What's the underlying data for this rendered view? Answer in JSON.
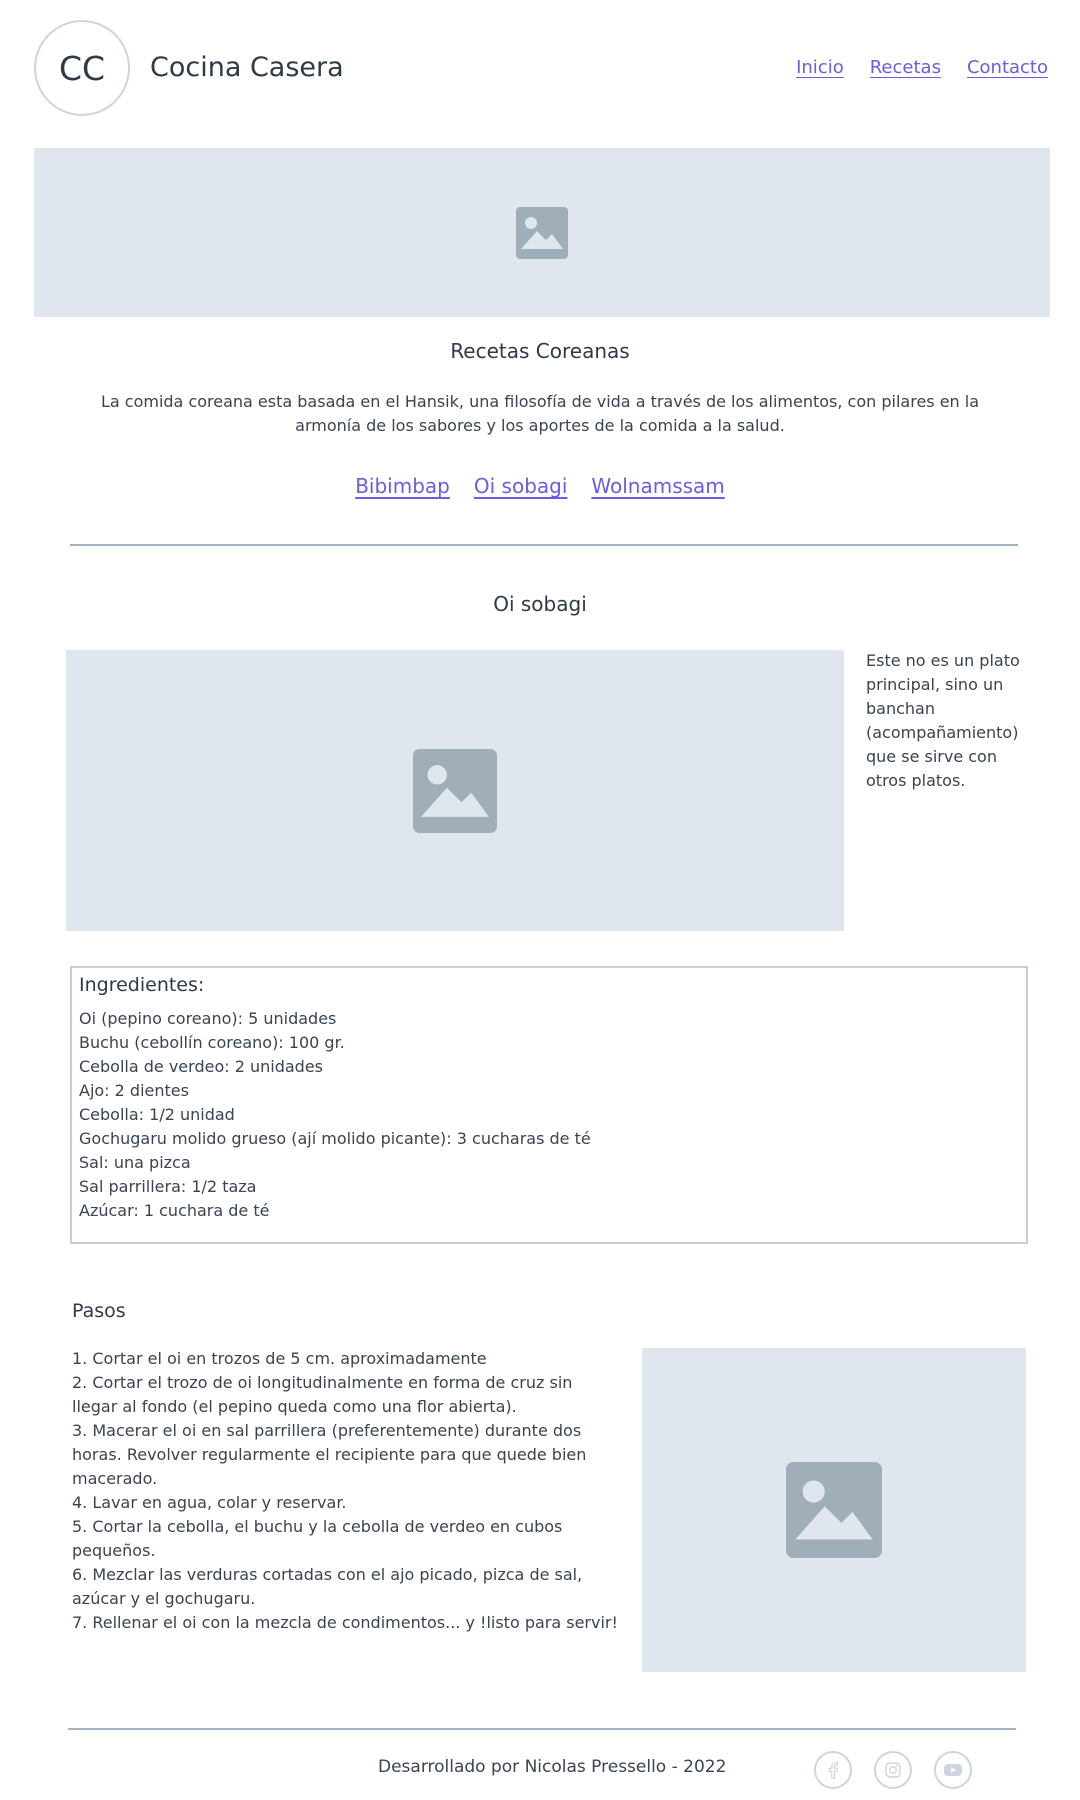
{
  "header": {
    "logo": "CC",
    "brand": "Cocina Casera",
    "nav": [
      "Inicio",
      "Recetas",
      "Contacto"
    ]
  },
  "hero": {
    "icon": "image-placeholder-icon"
  },
  "intro": {
    "title": "Recetas Coreanas",
    "text": "La comida coreana esta basada en el Hansik, una filosofía de vida a través de los alimentos, con pilares en la armonía de los sabores y los aportes de la comida a la salud.",
    "links": [
      "Bibimbap",
      "Oi sobagi",
      "Wolnamssam"
    ]
  },
  "recipe": {
    "title": "Oi sobagi",
    "description": "Este no es un plato principal, sino un banchan (acompañamiento) que se sirve con otros platos.",
    "ingredients_title": "Ingredientes:",
    "ingredients": [
      "Oi (pepino coreano): 5 unidades",
      "Buchu (cebollín coreano): 100 gr.",
      "Cebolla de verdeo: 2 unidades",
      "Ajo: 2 dientes",
      "Cebolla: 1/2 unidad",
      "Gochugaru molido grueso (ají molido picante): 3 cucharas de té",
      "Sal: una pizca",
      "Sal parrillera: 1/2 taza",
      "Azúcar: 1 cuchara de té"
    ],
    "steps_title": "Pasos",
    "steps": [
      "1. Cortar el oi en trozos de 5 cm. aproximadamente",
      "2. Cortar el trozo de oi longitudinalmente en forma de cruz sin llegar al fondo (el pepino queda como una flor abierta).",
      "3. Macerar el oi en sal parrillera (preferentemente) durante dos horas. Revolver regularmente el recipiente para que quede bien macerado.",
      "4. Lavar en agua, colar y reservar.",
      "5. Cortar la cebolla, el buchu y la cebolla de verdeo en cubos pequeños.",
      "6. Mezclar las verduras cortadas con el ajo picado, pizca de sal, azúcar y el gochugaru.",
      "7. Rellenar el oi con la mezcla de condimentos... y !listo para servir!"
    ]
  },
  "footer": {
    "text": "Desarrollado por Nicolas Pressello -  2022",
    "social": [
      "facebook-icon",
      "instagram-icon",
      "youtube-icon"
    ]
  },
  "colors": {
    "link": "#6c5ce0",
    "placeholder_bg": "#e0e6ee",
    "placeholder_icon": "#a0aeba",
    "divider": "#a3b3c6"
  }
}
